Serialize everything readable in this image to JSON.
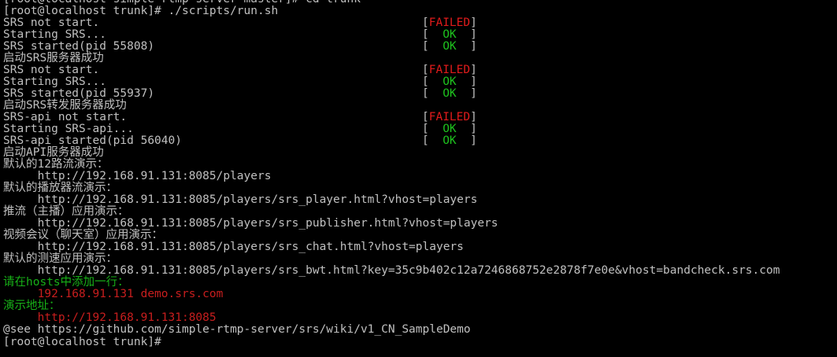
{
  "terminal": {
    "lines": [
      {
        "text": "[root@localhost simple-rtmp-server-master]# cd trunk",
        "color": "#c0c0c0"
      },
      {
        "text": "[root@localhost trunk]# ./scripts/run.sh",
        "color": "#c0c0c0"
      },
      {
        "text": "SRS not start.",
        "color": "#c0c0c0",
        "status": "FAILED"
      },
      {
        "text": "Starting SRS...",
        "color": "#c0c0c0",
        "status": "OK"
      },
      {
        "text": "SRS started(pid 55808)",
        "color": "#c0c0c0",
        "status": "OK"
      },
      {
        "text": "启动SRS服务器成功",
        "color": "#c0c0c0"
      },
      {
        "text": "SRS not start.",
        "color": "#c0c0c0",
        "status": "FAILED"
      },
      {
        "text": "Starting SRS...",
        "color": "#c0c0c0",
        "status": "OK"
      },
      {
        "text": "SRS started(pid 55937)",
        "color": "#c0c0c0",
        "status": "OK"
      },
      {
        "text": "启动SRS转发服务器成功",
        "color": "#c0c0c0"
      },
      {
        "text": "SRS-api not start.",
        "color": "#c0c0c0",
        "status": "FAILED"
      },
      {
        "text": "Starting SRS-api...",
        "color": "#c0c0c0",
        "status": "OK"
      },
      {
        "text": "SRS-api started(pid 56040)",
        "color": "#c0c0c0",
        "status": "OK"
      },
      {
        "text": "启动API服务器成功",
        "color": "#c0c0c0"
      },
      {
        "text": "默认的12路流演示：",
        "color": "#c0c0c0"
      },
      {
        "text": "     http://192.168.91.131:8085/players",
        "color": "#c0c0c0"
      },
      {
        "text": "默认的播放器流演示：",
        "color": "#c0c0c0"
      },
      {
        "text": "     http://192.168.91.131:8085/players/srs_player.html?vhost=players",
        "color": "#c0c0c0"
      },
      {
        "text": "推流（主播）应用演示：",
        "color": "#c0c0c0"
      },
      {
        "text": "     http://192.168.91.131:8085/players/srs_publisher.html?vhost=players",
        "color": "#c0c0c0"
      },
      {
        "text": "视频会议（聊天室）应用演示：",
        "color": "#c0c0c0"
      },
      {
        "text": "     http://192.168.91.131:8085/players/srs_chat.html?vhost=players",
        "color": "#c0c0c0"
      },
      {
        "text": "默认的测速应用演示：",
        "color": "#c0c0c0"
      },
      {
        "text": "     http://192.168.91.131:8085/players/srs_bwt.html?key=35c9b402c12a7246868752e2878f7e0e&vhost=bandcheck.srs.com",
        "color": "#c0c0c0"
      },
      {
        "text": "请在hosts中添加一行：",
        "color": "#17b017"
      },
      {
        "text": "     192.168.91.131 demo.srs.com",
        "color": "#c81e1e"
      },
      {
        "text": "演示地址：",
        "color": "#17b017"
      },
      {
        "text": "     http://192.168.91.131:8085",
        "color": "#c81e1e"
      },
      {
        "text": "@see https://github.com/simple-rtmp-server/srs/wiki/v1_CN_SampleDemo",
        "color": "#c0c0c0"
      },
      {
        "text": "[root@localhost trunk]#",
        "color": "#c0c0c0"
      }
    ],
    "status_labels": {
      "FAILED": "FAILED",
      "OK": "OK"
    },
    "status_colors": {
      "FAILED": "#e01b1b",
      "OK": "#1ec21e",
      "bracket": "#c0c0c0"
    }
  }
}
